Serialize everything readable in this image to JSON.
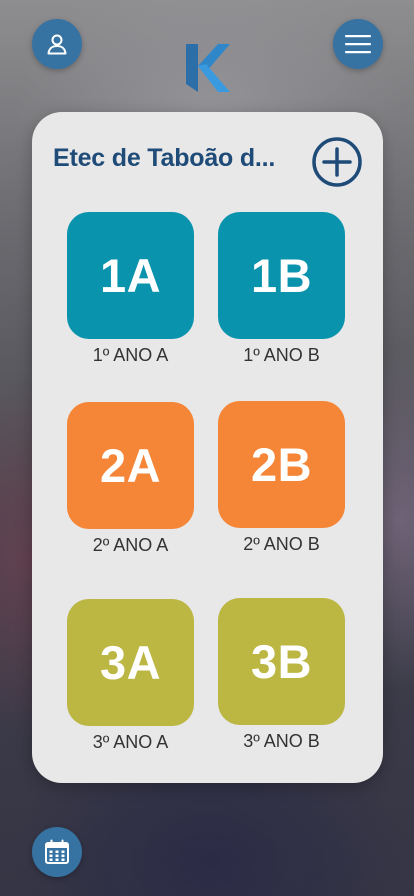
{
  "header": {
    "profile_icon": "user-icon",
    "menu_icon": "hamburger-menu-icon",
    "logo_icon": "k-logo-icon"
  },
  "panel": {
    "title": "Etec de Taboão d...",
    "add_icon": "plus-circle-icon"
  },
  "classes": [
    {
      "code": "1A",
      "name": "1º ANO A",
      "color": "#0a93ad"
    },
    {
      "code": "1B",
      "name": "1º ANO B",
      "color": "#0a93ad"
    },
    {
      "code": "2A",
      "name": "2º ANO A",
      "color": "#f58537"
    },
    {
      "code": "2B",
      "name": "2º ANO B",
      "color": "#f58537"
    },
    {
      "code": "3A",
      "name": "3º ANO A",
      "color": "#bcb643"
    },
    {
      "code": "3B",
      "name": "3º ANO B",
      "color": "#bcb643"
    }
  ],
  "footer": {
    "calendar_icon": "calendar-icon"
  },
  "colors": {
    "accent": "#3673a3",
    "title": "#1f4b78",
    "card_bg": "#e8e8e8"
  }
}
